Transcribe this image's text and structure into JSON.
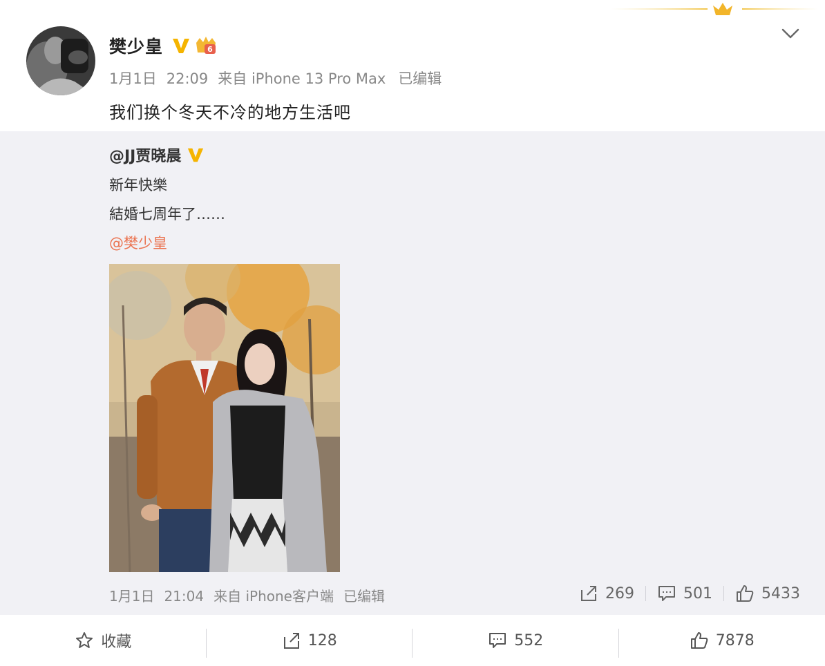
{
  "post": {
    "author": "樊少皇",
    "date": "1月1日",
    "time": "22:09",
    "source": "来自 iPhone 13 Pro Max",
    "edited": "已编辑",
    "text": "我们换个冬天不冷的地方生活吧"
  },
  "repost": {
    "author": "@JJ贾晓晨",
    "line1": "新年快樂",
    "line2": "結婚七周年了……",
    "mention": "@樊少皇",
    "date": "1月1日",
    "time": "21:04",
    "source": "来自 iPhone客户端",
    "edited": "已编辑",
    "stats": {
      "reposts": "269",
      "comments": "501",
      "likes": "5433"
    }
  },
  "toolbar": {
    "favorite_label": "收藏",
    "repost_count": "128",
    "comment_count": "552",
    "like_count": "7878"
  },
  "colors": {
    "verified": "#f5b400",
    "mention": "#eb7350",
    "repost_bg": "#f1f1f5",
    "meta": "#888888"
  },
  "icons": [
    "crown-icon",
    "verified-icon",
    "level-badge-icon",
    "chevron-down-icon",
    "repost-icon",
    "comment-icon",
    "like-icon",
    "star-icon"
  ]
}
